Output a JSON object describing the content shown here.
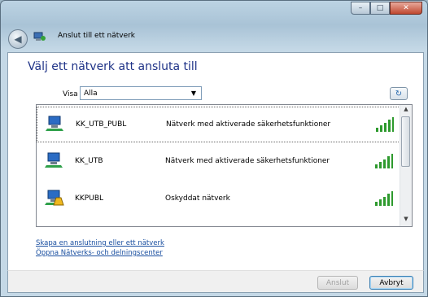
{
  "window": {
    "title": "Anslut till ett nätverk",
    "minimize_glyph": "–",
    "maximize_glyph": "□",
    "close_glyph": "✕",
    "back_icon": "back-arrow-icon"
  },
  "heading": "Välj ett nätverk att ansluta till",
  "filter": {
    "label": "Visa",
    "selected": "Alla",
    "arrow_glyph": "▼"
  },
  "refresh_glyph": "↻",
  "networks": [
    {
      "name": "KK_UTB_PUBL",
      "description": "Nätverk med aktiverade säkerhetsfunktioner",
      "secured": true,
      "signal_bars": 5,
      "selected": true
    },
    {
      "name": "KK_UTB",
      "description": "Nätverk med aktiverade säkerhetsfunktioner",
      "secured": true,
      "signal_bars": 5,
      "selected": false
    },
    {
      "name": "KKPUBL",
      "description": "Oskyddat nätverk",
      "secured": false,
      "signal_bars": 5,
      "selected": false
    }
  ],
  "scrollbar": {
    "up_glyph": "▲",
    "down_glyph": "▼"
  },
  "links": {
    "setup": "Skapa en anslutning eller ett nätverk",
    "center": "Öppna Nätverks- och delningscenter"
  },
  "buttons": {
    "connect": "Anslut",
    "cancel": "Avbryt"
  },
  "colors": {
    "heading": "#1e3287",
    "link": "#1a4fa0",
    "signal": "#2e9a2e"
  }
}
